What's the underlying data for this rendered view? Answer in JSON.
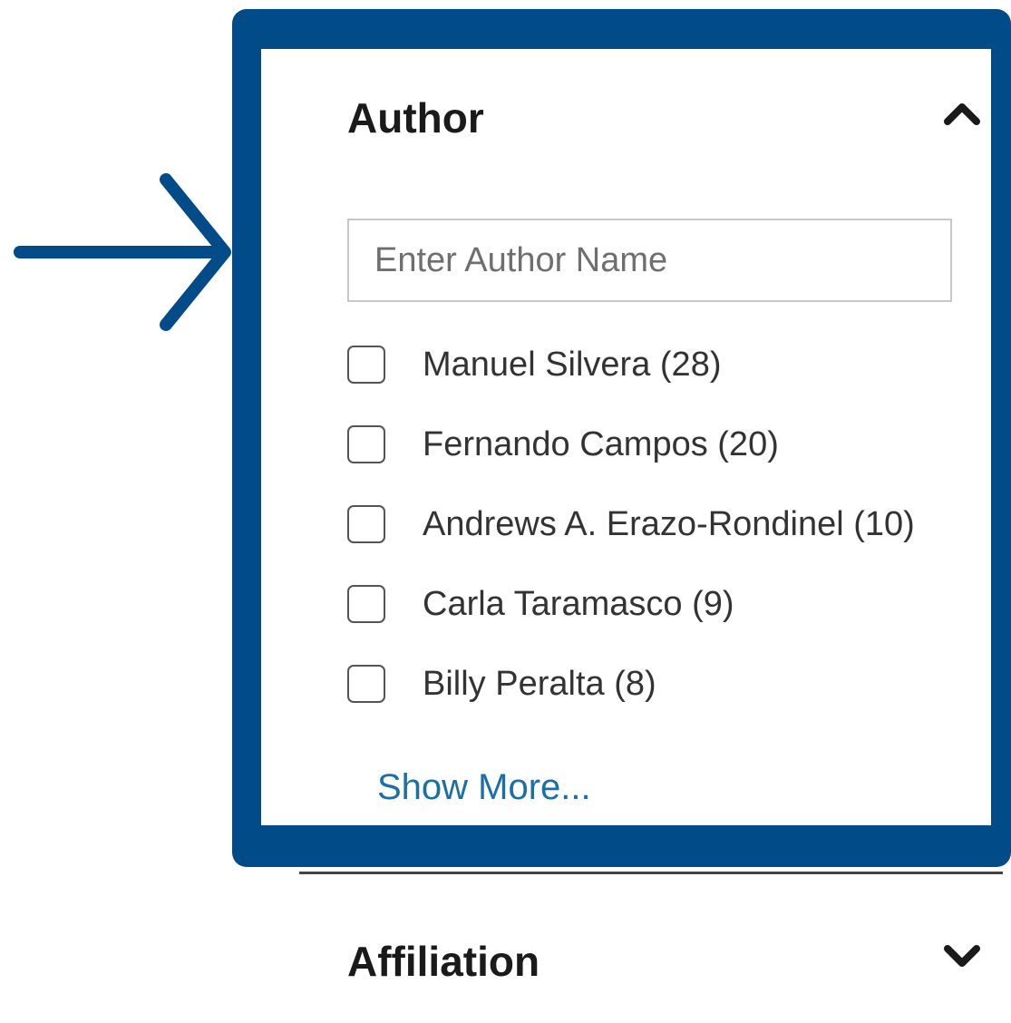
{
  "author_section": {
    "title": "Author",
    "chevron_icon": "chevron-up-icon",
    "search": {
      "placeholder": "Enter Author Name",
      "value": ""
    },
    "authors": [
      {
        "label": "Manuel Silvera (28)",
        "checked": false
      },
      {
        "label": "Fernando Campos (20)",
        "checked": false
      },
      {
        "label": "Andrews A. Erazo-Rondinel (10)",
        "checked": false
      },
      {
        "label": "Carla Taramasco (9)",
        "checked": false
      },
      {
        "label": "Billy Peralta (8)",
        "checked": false
      }
    ],
    "show_more_label": "Show More..."
  },
  "affiliation_section": {
    "title": "Affiliation",
    "chevron_icon": "chevron-down-icon"
  },
  "colors": {
    "highlight_border": "#014b88",
    "arrow": "#014b88",
    "link": "#1a6fa9"
  }
}
